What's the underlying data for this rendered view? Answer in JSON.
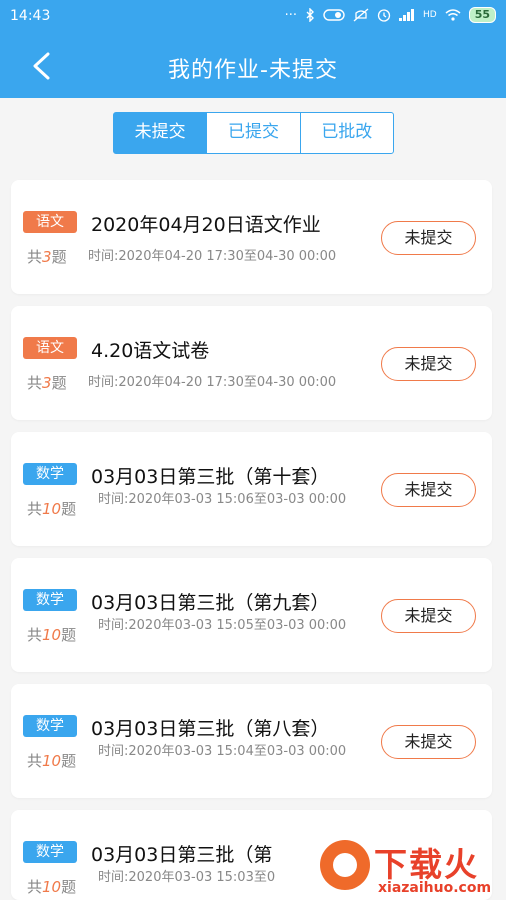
{
  "status_bar": {
    "time": "14:43",
    "battery": "55",
    "icons": [
      "signal-dots-icon",
      "bluetooth-icon",
      "toggle-icon",
      "mute-icon",
      "alarm-icon",
      "cell-signal-icon",
      "hd-icon",
      "wifi-icon",
      "battery-icon"
    ]
  },
  "header": {
    "title": "我的作业-未提交",
    "back_icon": "chevron-left-icon"
  },
  "tabs": [
    {
      "label": "未提交",
      "active": true
    },
    {
      "label": "已提交",
      "active": false
    },
    {
      "label": "已批改",
      "active": false
    }
  ],
  "assignments": [
    {
      "subject": "语文",
      "title": "2020年04月20日语文作业",
      "count_prefix": "共",
      "count": "3",
      "count_suffix": "题",
      "time": "时间:2020年04-20 17:30至04-30 00:00",
      "status": "未提交"
    },
    {
      "subject": "语文",
      "title": "4.20语文试卷",
      "count_prefix": "共",
      "count": "3",
      "count_suffix": "题",
      "time": "时间:2020年04-20 17:30至04-30 00:00",
      "status": "未提交"
    },
    {
      "subject": "数学",
      "title": "03月03日第三批（第十套）",
      "count_prefix": "共",
      "count": "10",
      "count_suffix": "题",
      "time": "时间:2020年03-03 15:06至03-03 00:00",
      "status": "未提交"
    },
    {
      "subject": "数学",
      "title": "03月03日第三批（第九套）",
      "count_prefix": "共",
      "count": "10",
      "count_suffix": "题",
      "time": "时间:2020年03-03 15:05至03-03 00:00",
      "status": "未提交"
    },
    {
      "subject": "数学",
      "title": "03月03日第三批（第八套）",
      "count_prefix": "共",
      "count": "10",
      "count_suffix": "题",
      "time": "时间:2020年03-03 15:04至03-03 00:00",
      "status": "未提交"
    },
    {
      "subject": "数学",
      "title": "03月03日第三批（第",
      "count_prefix": "共",
      "count": "10",
      "count_suffix": "题",
      "time": "时间:2020年03-03 15:03至0",
      "status": ""
    }
  ],
  "watermark": {
    "main": "下载火",
    "sub": "xiazaihuo.com"
  },
  "colors": {
    "primary": "#3aa6ee",
    "accent": "#f07a4a",
    "watermark": "#e8412a"
  }
}
